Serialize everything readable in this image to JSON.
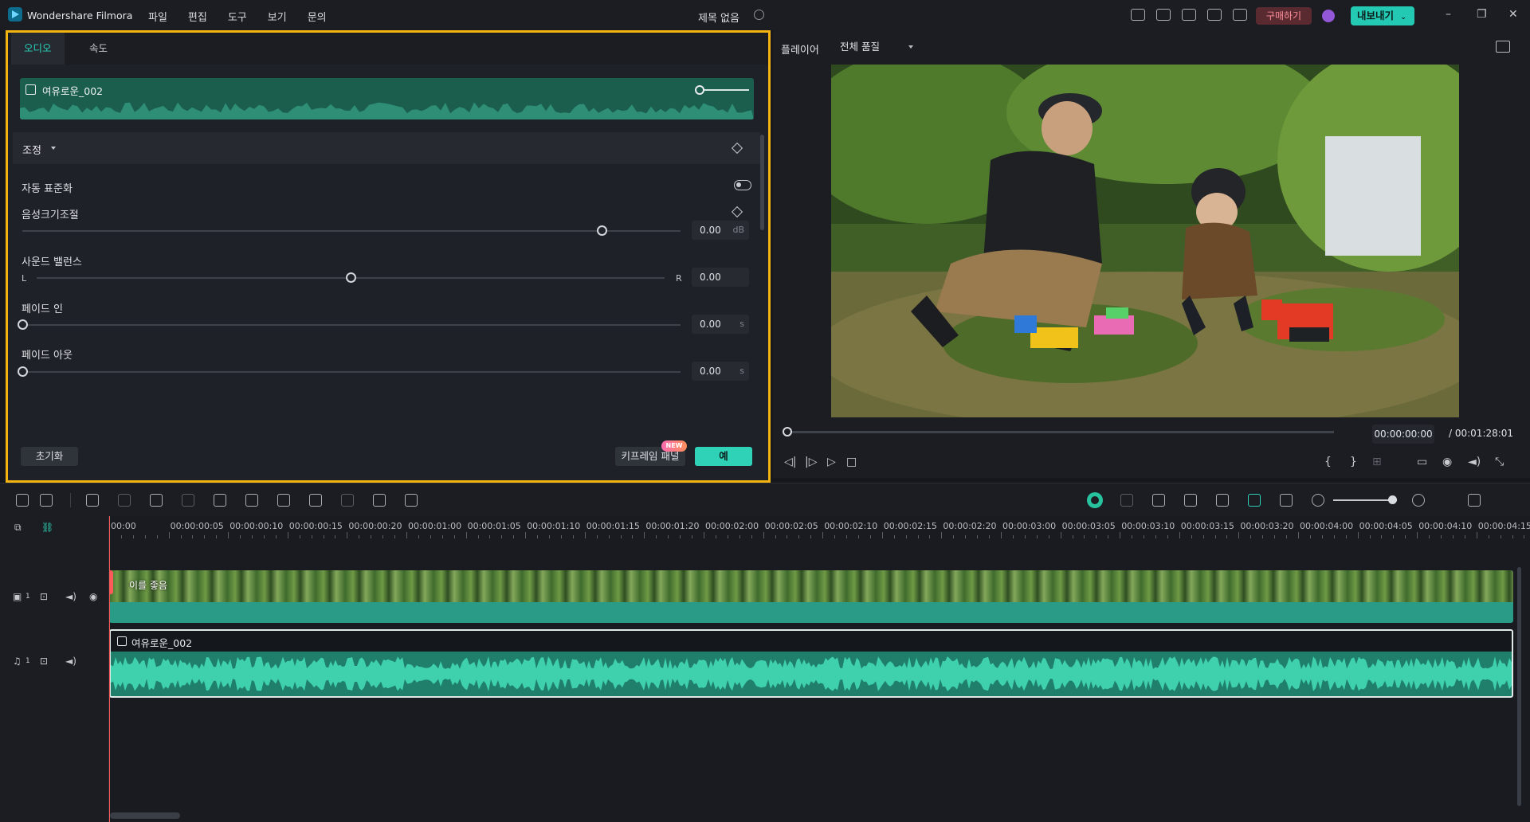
{
  "app": {
    "name": "Wondershare Filmora",
    "menu": [
      "파일",
      "편집",
      "도구",
      "보기",
      "문의"
    ],
    "doc_title": "제목 없음",
    "buy_label": "구매하기",
    "export_label": "내보내기"
  },
  "audio_panel": {
    "tabs": [
      "오디오",
      "속도"
    ],
    "clip_name": "여유로운_002",
    "clip_volume_level": 0.06,
    "section_title": "조정",
    "auto_normalize_label": "자동 표준화",
    "auto_normalize_on": false,
    "volume": {
      "label": "음성크기조절",
      "value": "0.00",
      "unit": "dB",
      "position": 0.88
    },
    "balance": {
      "label": "사운드 밸런스",
      "left": "L",
      "right": "R",
      "value": "0.00",
      "position": 0.5
    },
    "fade_in": {
      "label": "페이드 인",
      "value": "0.00",
      "unit": "s",
      "position": 0.0
    },
    "fade_out": {
      "label": "페이드 아웃",
      "value": "0.00",
      "unit": "s",
      "position": 0.0
    },
    "reset_label": "초기화",
    "keyframe_label": "키프레임 패널",
    "new_badge": "NEW",
    "ok_label": "예"
  },
  "player": {
    "label": "플레이어",
    "quality": "전체 품질",
    "timecode": "00:00:00:00",
    "duration": "/ 00:01:28:01",
    "progress": 0.0
  },
  "timeline": {
    "ruler": [
      "00:00",
      "00:00:00:05",
      "00:00:00:10",
      "00:00:00:15",
      "00:00:00:20",
      "00:00:01:00",
      "00:00:01:05",
      "00:00:01:10",
      "00:00:01:15",
      "00:00:01:20",
      "00:00:02:00",
      "00:00:02:05",
      "00:00:02:10",
      "00:00:02:15",
      "00:00:02:20",
      "00:00:03:00",
      "00:00:03:05",
      "00:00:03:10",
      "00:00:03:15",
      "00:00:03:20",
      "00:00:04:00",
      "00:00:04:05",
      "00:00:04:10",
      "00:00:04:15"
    ],
    "video_clip_label": "이를 좋음",
    "audio_clip_name": "여유로운_002",
    "video_track_num": "1",
    "audio_track_num": "1"
  },
  "colors": {
    "accent": "#2fd2b7",
    "highlight_border": "#f3b412",
    "playhead": "#ff5a5a",
    "audio_clip": "#1f7f6b"
  }
}
